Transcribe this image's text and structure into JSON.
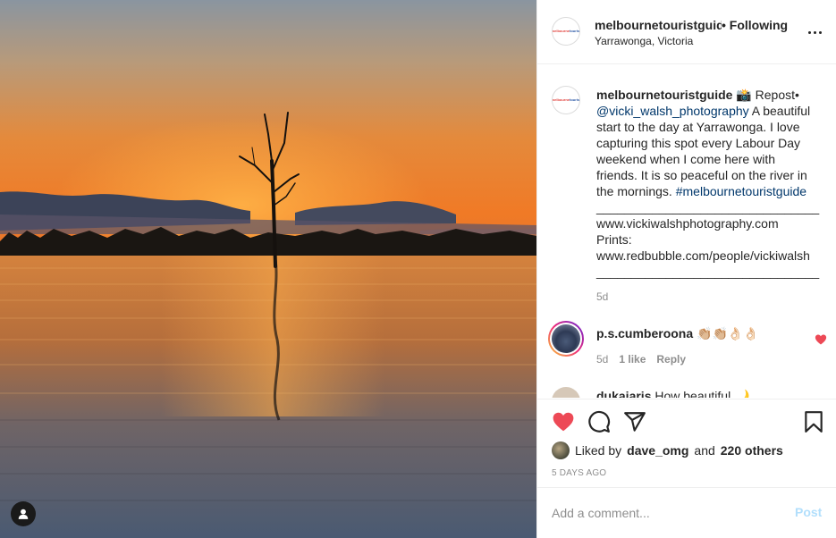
{
  "post": {
    "username": "melbournetouristguide",
    "following_label": "• Following",
    "location": "Yarrawonga, Victoria",
    "more_icon": "more-horizontal-icon"
  },
  "caption": {
    "username": "melbournetouristguide",
    "lines": [
      " 📸 Repost•",
      "@vicki_walsh_photography",
      " A beautiful",
      "start to the day at Yarrawonga. I love",
      "capturing this spot every Labour Day",
      "weekend when I come here with",
      "friends. It is so peaceful on the river in",
      "the mornings. ",
      "#melbournetouristguide",
      "________________________________",
      "www.vickiwalshphotography.com",
      "Prints:",
      "www.redbubble.com/people/vickiwalsh",
      "________________________________"
    ],
    "time": "5d"
  },
  "comments": [
    {
      "username": "p.s.cumberoona",
      "text": " 👏🏼👏🏼👌🏻👌🏻",
      "time": "5d",
      "likes": "1 like",
      "reply": "Reply"
    },
    {
      "username": "dukaiaris",
      "text": " How beautiful 🌙"
    }
  ],
  "actions": {
    "like_icon": "heart-filled-icon",
    "comment_icon": "comment-icon",
    "share_icon": "paper-plane-icon",
    "save_icon": "bookmark-icon",
    "liked_by_prefix": "Liked by",
    "liked_by_user": "dave_omg",
    "liked_by_and": "and",
    "liked_by_others": "220 others",
    "date": "5 DAYS AGO"
  },
  "composer": {
    "placeholder": "Add a comment...",
    "post_label": "Post"
  },
  "colors": {
    "heart": "#ed4956",
    "link": "#00376b",
    "post_disabled": "#b2dffc"
  }
}
